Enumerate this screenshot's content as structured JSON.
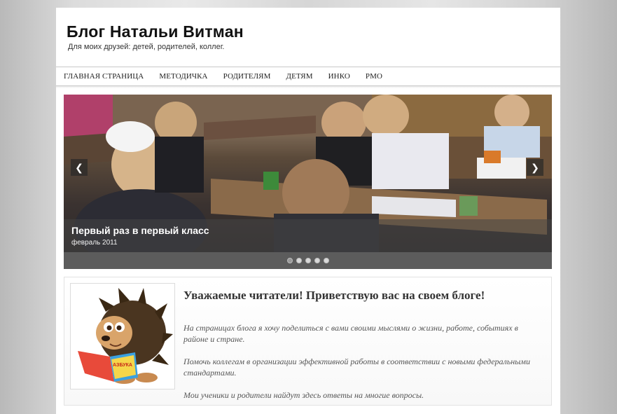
{
  "site": {
    "title": "Блог Натальи Витман",
    "tagline": "Для моих друзей: детей, родителей, коллег."
  },
  "nav": {
    "items": [
      {
        "label": "ГЛАВНАЯ СТРАНИЦА"
      },
      {
        "label": "МЕТОДИЧКА"
      },
      {
        "label": "РОДИТЕЛЯМ"
      },
      {
        "label": "ДЕТЯМ"
      },
      {
        "label": "ИНКО"
      },
      {
        "label": "РМО"
      }
    ]
  },
  "slider": {
    "title": "Первый раз в первый класс",
    "date": "февраль 2011",
    "prev_icon": "chevron-left-icon",
    "next_icon": "chevron-right-icon",
    "slide_count": 5,
    "active_index": 0
  },
  "welcome": {
    "heading": "Уважаемые читатели! Приветствую вас на своем блоге!",
    "paragraphs": [
      "На страницах блога я хочу поделиться с вами своими мыслями о жизни, работе, событиях в районе и стране.",
      "Помочь коллегам в организации эффективной работы в соответствии с новыми федеральными стандартами.",
      "Мои ученики и родители найдут здесь ответы на многие вопросы."
    ],
    "book_label": "АЗБУКА"
  },
  "colors": {
    "page_bg": "#ffffff",
    "text": "#111111",
    "caption_band": "#464646"
  }
}
